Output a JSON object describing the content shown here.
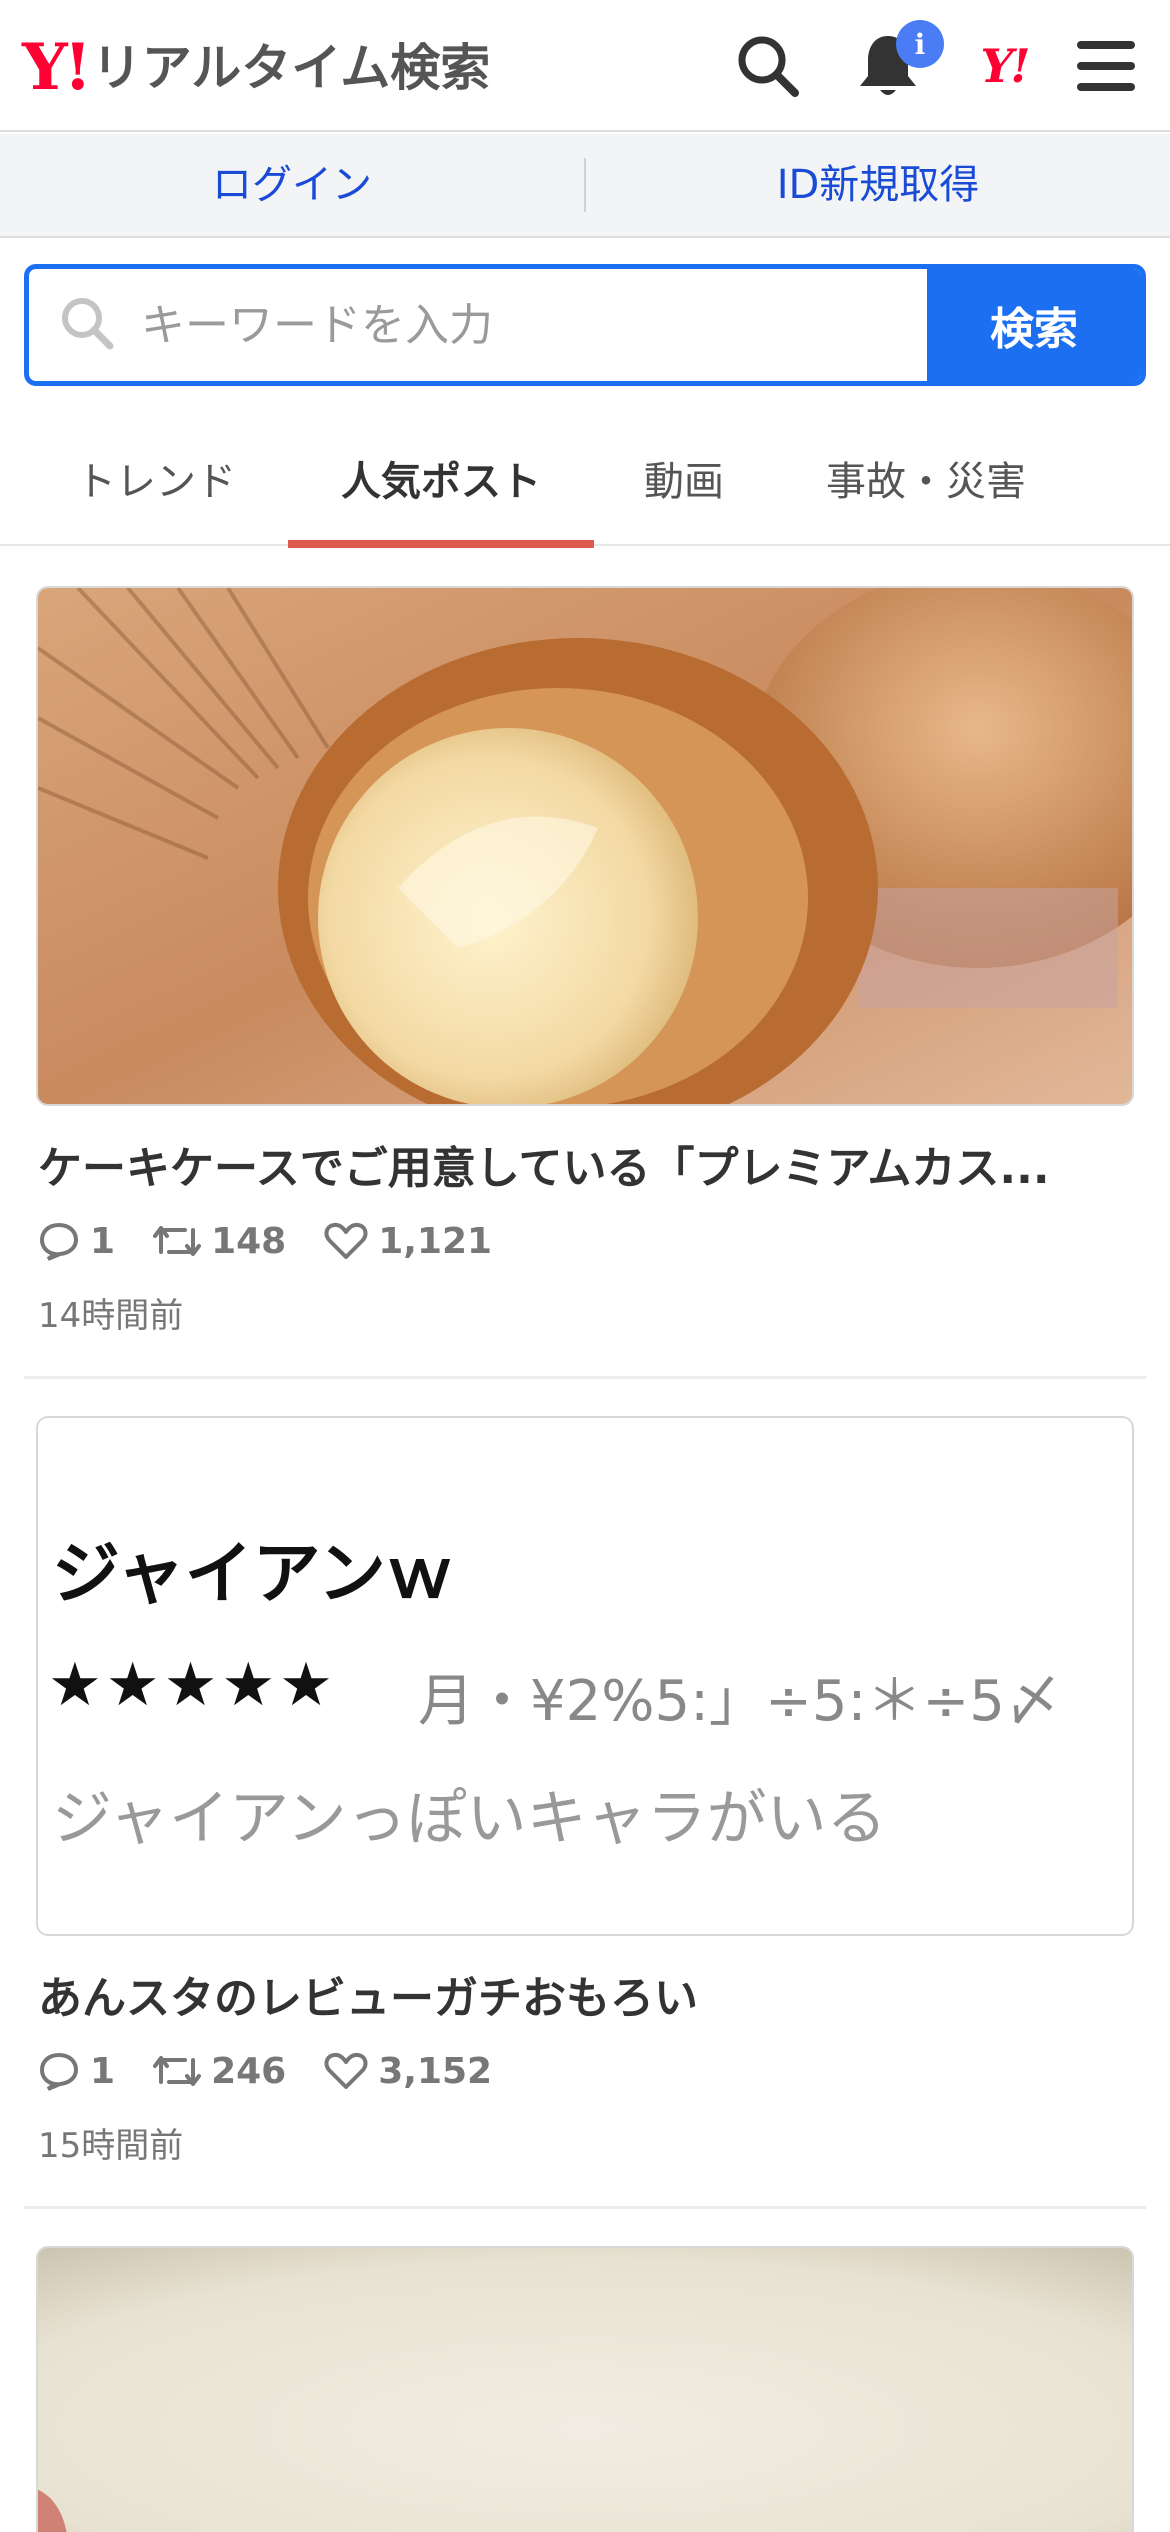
{
  "header": {
    "logo_mark": "Y!",
    "logo_text": "リアルタイム検索",
    "notification_badge": "i",
    "yahoo_mini": "Y!"
  },
  "login_bar": {
    "login": "ログイン",
    "register": "ID新規取得"
  },
  "search": {
    "placeholder": "キーワードを入力",
    "button": "検索"
  },
  "tabs": [
    {
      "label": "トレンド",
      "active": false
    },
    {
      "label": "人気ポスト",
      "active": true
    },
    {
      "label": "動画",
      "active": false
    },
    {
      "label": "事故・災害",
      "active": false
    }
  ],
  "posts": [
    {
      "image": "cream-puff-photo",
      "title": "ケーキケースでご用意している「プレミアムカス...",
      "replies": "1",
      "reposts": "148",
      "likes": "1,121",
      "time": "14時間前"
    },
    {
      "image": {
        "title": "ジャイアンｗ",
        "stars": "★★★★★",
        "meta": "月・¥2%5:」÷5:＊÷5〆",
        "body": "ジャイアンっぽいキャラがいる"
      },
      "title": "あんスタのレビューガチおもろい",
      "replies": "1",
      "reposts": "246",
      "likes": "3,152",
      "time": "15時間前"
    },
    {
      "image": "blurred-photo"
    }
  ],
  "colors": {
    "brand_red": "#ff0033",
    "accent_blue": "#1d6ff2",
    "tab_underline": "#e05a4e"
  }
}
